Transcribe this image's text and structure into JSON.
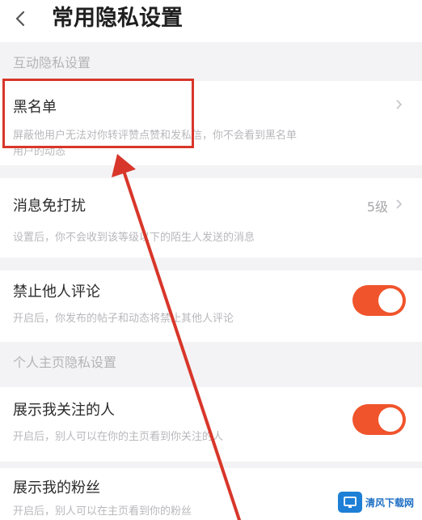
{
  "header": {
    "title": "常用隐私设置",
    "back_icon": "back-arrow-icon"
  },
  "sections": {
    "interaction": {
      "title": "互动隐私设置"
    },
    "profile": {
      "title": "个人主页隐私设置"
    }
  },
  "items": {
    "blacklist": {
      "title": "黑名单",
      "desc_line1": "屏蔽他用户无法对你转评赞点赞和发私信，你不会看到黑名单",
      "desc_line2": "用户的动态"
    },
    "dnd": {
      "title": "消息免打扰",
      "value": "5级",
      "desc": "设置后，你不会收到该等级以下的陌生人发送的消息"
    },
    "no_comment": {
      "title": "禁止他人评论",
      "desc": "开启后，你发布的帖子和动态将禁止其他人评论",
      "enabled": true
    },
    "show_following": {
      "title": "展示我关注的人",
      "desc": "开启后，别人可以在你的主页看到你关注的人",
      "enabled": true
    },
    "show_fans": {
      "title": "展示我的粉丝",
      "desc": "开启后，别人可以在主页看到你的粉丝"
    }
  },
  "annotation": {
    "highlight_color": "#d8362a",
    "arrow_color": "#d8362a"
  },
  "watermark": {
    "text": "清风下载网",
    "logo_icon": "download-site-logo-icon"
  },
  "colors": {
    "accent": "#f0542c",
    "background": "#f3f3f5",
    "title": "#1f1f1f",
    "muted": "#b8b8bc"
  }
}
